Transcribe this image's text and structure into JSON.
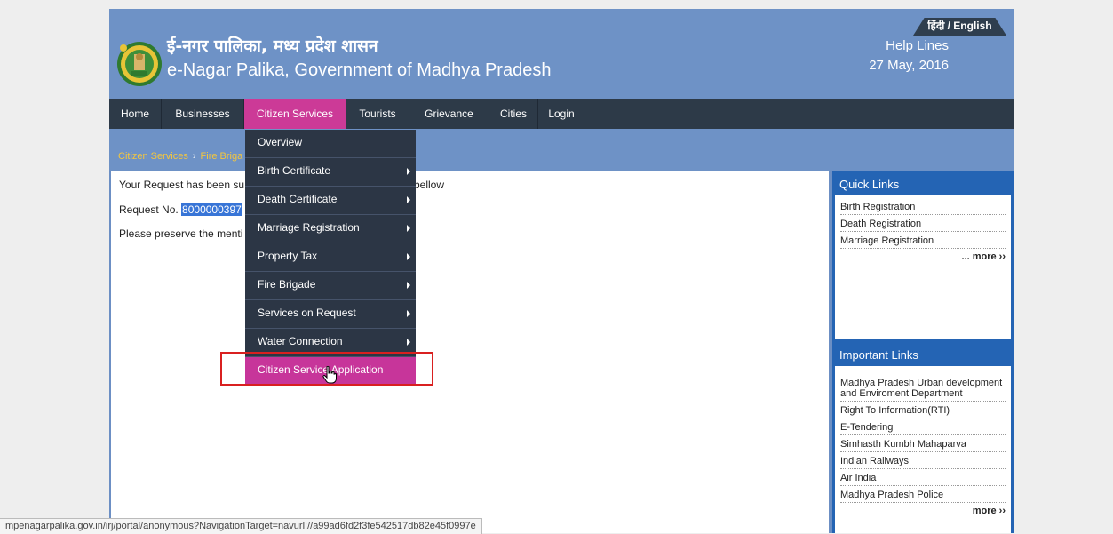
{
  "header": {
    "title_hindi": "ई-नगर पालिका, मध्य प्रदेश शासन",
    "title_english": "e-Nagar Palika, Government of Madhya Pradesh",
    "lang_toggle": "हिंदी / English",
    "help_lines": "Help Lines",
    "date": "27 May, 2016"
  },
  "nav": {
    "items": [
      "Home",
      "Businesses",
      "Citizen Services",
      "Tourists",
      "Grievance",
      "Cities",
      "Login"
    ],
    "active": "Citizen Services"
  },
  "breadcrumb": [
    "Citizen Services",
    "Fire Briga"
  ],
  "main": {
    "line1_start": "Your Request has been su",
    "line1_end": "bellow",
    "request_label": "Request No.",
    "request_number": "8000000397",
    "line3": "Please preserve the menti"
  },
  "dropdown": {
    "items": [
      {
        "label": "Overview",
        "submenu": false
      },
      {
        "label": "Birth Certificate",
        "submenu": true
      },
      {
        "label": "Death Certificate",
        "submenu": true
      },
      {
        "label": "Marriage Registration",
        "submenu": true
      },
      {
        "label": "Property Tax",
        "submenu": true
      },
      {
        "label": "Fire Brigade",
        "submenu": true
      },
      {
        "label": "Services on Request",
        "submenu": true
      },
      {
        "label": "Water Connection",
        "submenu": true
      },
      {
        "label": "Citizen Service Application Status",
        "submenu": false
      }
    ],
    "highlighted": "Citizen Service Application Status"
  },
  "quick_links": {
    "title": "Quick Links",
    "items": [
      "Birth Registration",
      "Death Registration",
      "Marriage Registration"
    ],
    "more": "... more ››"
  },
  "important_links": {
    "title": "Important Links",
    "items": [
      "Madhya Pradesh Urban development and Enviroment Department",
      "Right To Information(RTI)",
      "E-Tendering",
      "Simhasth Kumbh Mahaparva",
      "Indian Railways",
      "Air India",
      "Madhya Pradesh Police"
    ],
    "more": "more ››"
  },
  "status_bar": {
    "url": "mpenagarpalika.gov.in/irj/portal/anonymous?NavigationTarget=navurl://a99ad6fd2f3fe542517db82e45f0997e"
  },
  "colors": {
    "header_bg": "#6e92c6",
    "nav_bg": "#2d3a48",
    "accent": "#cc3a97",
    "sidebar_blue": "#2464b4",
    "breadcrumb": "#f4c63d"
  }
}
